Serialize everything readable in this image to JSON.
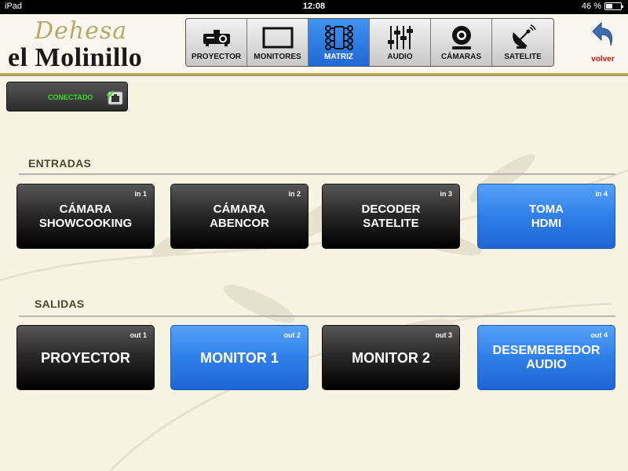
{
  "status_bar": {
    "device": "iPad",
    "time": "12:08",
    "battery": "46 %",
    "battery_level": 0.46
  },
  "logo": {
    "script_text": "Dehesa",
    "main_text": "el Molinillo"
  },
  "tabs": [
    {
      "label": "PROYECTOR",
      "icon": "projector-icon",
      "active": false
    },
    {
      "label": "MONITORES",
      "icon": "monitor-icon",
      "active": false
    },
    {
      "label": "MATRIZ",
      "icon": "matrix-icon",
      "active": true
    },
    {
      "label": "AUDIO",
      "icon": "sliders-icon",
      "active": false
    },
    {
      "label": "CÁMARAS",
      "icon": "camera-icon",
      "active": false
    },
    {
      "label": "SATELITE",
      "icon": "satellite-dish-icon",
      "active": false
    }
  ],
  "back_button": {
    "label": "volver",
    "icon": "back-arrow-icon"
  },
  "connection": {
    "label": "CONECTADO",
    "icon": "network-connected-icon"
  },
  "inputs": {
    "title": "ENTRADAS",
    "items": [
      {
        "tag": "in 1",
        "label": "CÁMARA\nSHOWCOOKING",
        "selected": false
      },
      {
        "tag": "in 2",
        "label": "CÁMARA\nABENCOR",
        "selected": false
      },
      {
        "tag": "in 3",
        "label": "DECODER\nSATELITE",
        "selected": false
      },
      {
        "tag": "in 4",
        "label": "TOMA\nHDMI",
        "selected": true
      }
    ]
  },
  "outputs": {
    "title": "SALIDAS",
    "items": [
      {
        "tag": "out 1",
        "label": "PROYECTOR",
        "selected": false
      },
      {
        "tag": "out 2",
        "label": "MONITOR 1",
        "selected": true
      },
      {
        "tag": "out 3",
        "label": "MONITOR 2",
        "selected": false
      },
      {
        "tag": "out 4",
        "label": "DESEMBEBEDOR\nAUDIO",
        "selected": false
      }
    ]
  },
  "colors": {
    "accent_blue": "#2f7fe8",
    "background": "#f7f3e2",
    "gold": "#b7a867",
    "connected_green": "#35e020",
    "back_red": "#d01010"
  }
}
